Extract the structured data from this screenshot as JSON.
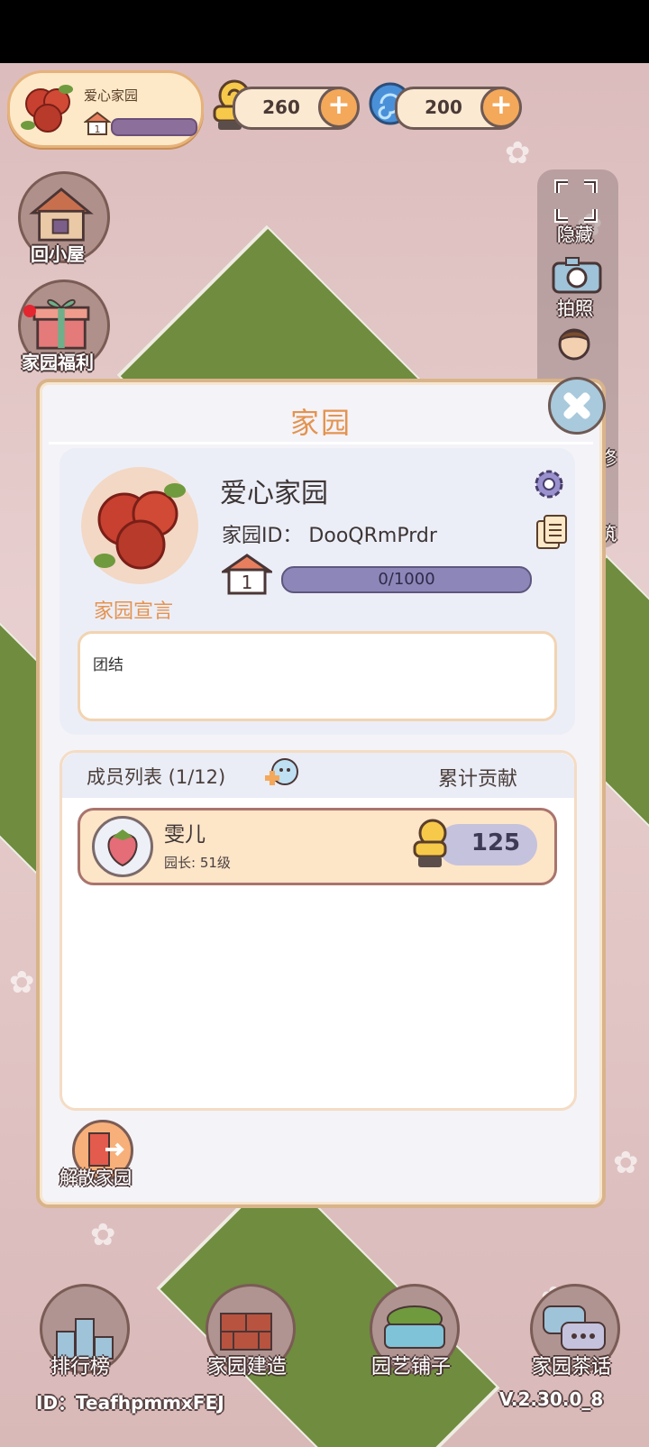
{
  "topbar": {
    "garden_name": "爱心家园",
    "garden_level": "1",
    "snail_coins": "260",
    "swirl_currency": "200"
  },
  "left_menu": {
    "home_label": "回小屋",
    "welfare_label": "家园福利"
  },
  "right_menu": {
    "hide_label": "隐藏",
    "photo_label": "拍照",
    "decorate_label": "修",
    "build_label": "筑"
  },
  "modal": {
    "title": "家园",
    "garden_name": "爱心家园",
    "garden_id": "家园ID： DooQRmPrdr",
    "level": "1",
    "exp_text": "0/1000",
    "exp_fraction": 0,
    "manifesto_label": "家园宣言",
    "manifesto_text": "团结",
    "member_list_title": "成员列表 (1/12)",
    "contribution_title": "累计贡献",
    "members": [
      {
        "name": "雯儿",
        "role": "园长: 51级",
        "contribution": "125"
      }
    ],
    "disband_label": "解散家园"
  },
  "bottom_nav": {
    "rank_label": "排行榜",
    "build_label": "家园建造",
    "shop_label": "园艺铺子",
    "chat_label": "家园茶话"
  },
  "footer": {
    "user_id": "ID：TeafhpmmxFEJ",
    "version": "V.2.30.0_8"
  },
  "colors": {
    "accent_orange": "#e4934f",
    "exp_bar": "#8d86b8",
    "modal_bg": "#f4f3f8"
  }
}
